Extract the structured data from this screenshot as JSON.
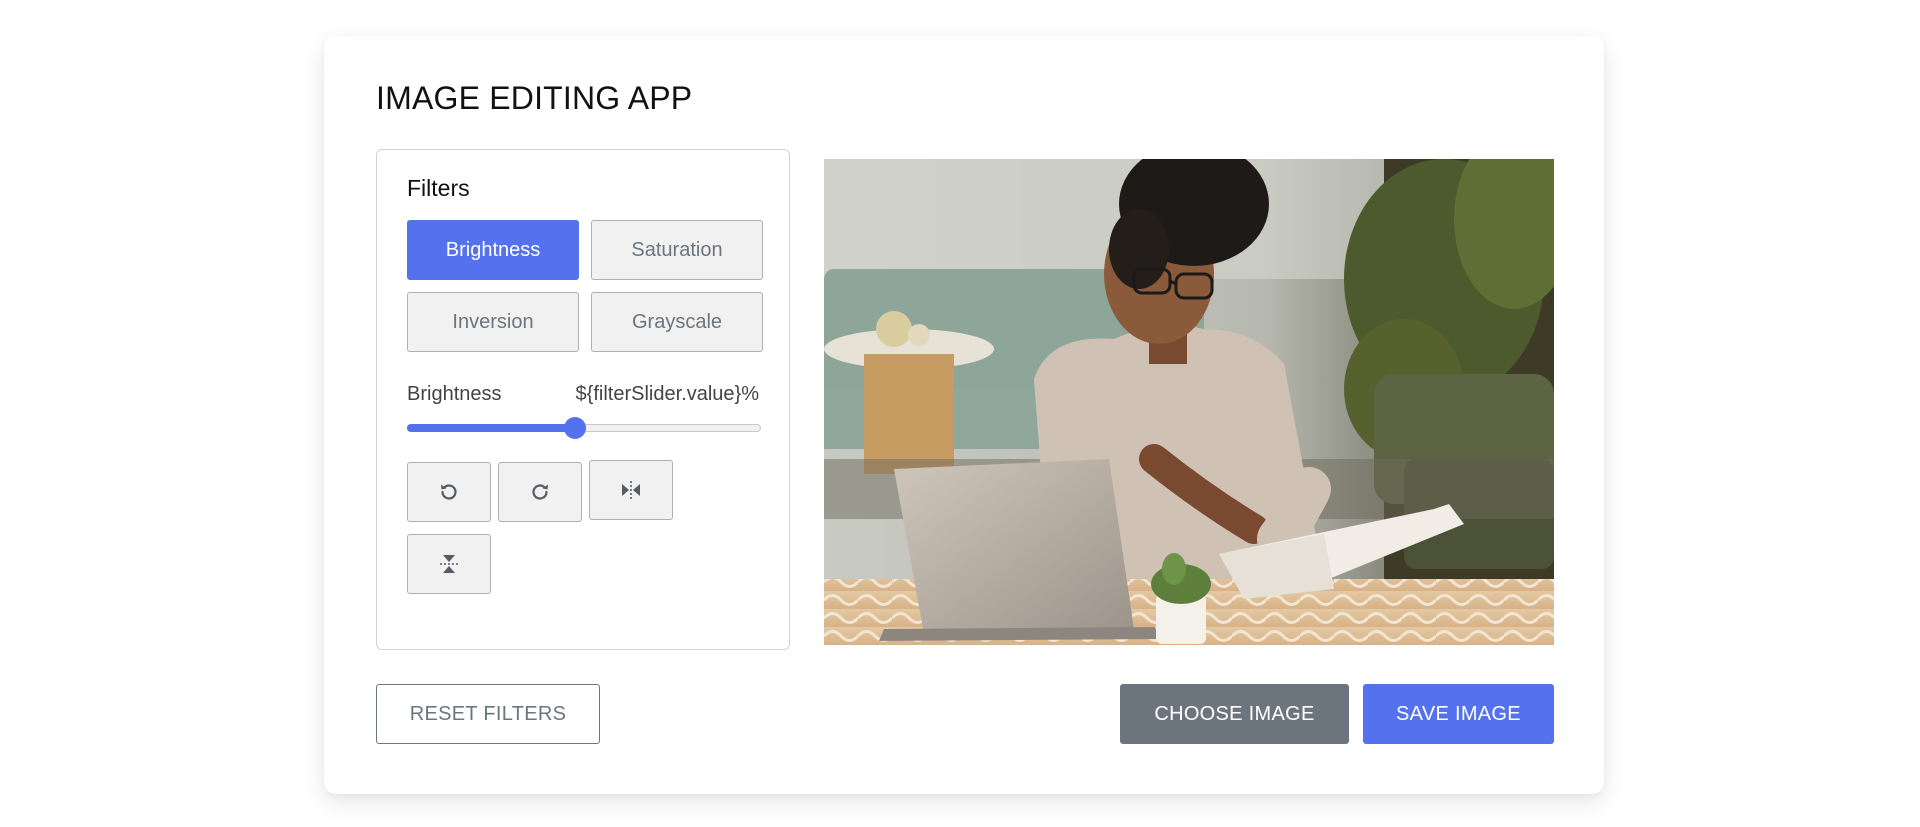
{
  "app": {
    "title": "IMAGE EDITING APP"
  },
  "filters": {
    "heading": "Filters",
    "options": [
      {
        "label": "Brightness",
        "active": true
      },
      {
        "label": "Saturation",
        "active": false
      },
      {
        "label": "Inversion",
        "active": false
      },
      {
        "label": "Grayscale",
        "active": false
      }
    ]
  },
  "slider": {
    "name": "Brightness",
    "value_text": "${filterSlider.value}%",
    "level_fraction": 0.475
  },
  "transform_buttons": [
    {
      "icon": "rotate-left-icon"
    },
    {
      "icon": "rotate-right-icon"
    },
    {
      "icon": "flip-horizontal-icon"
    },
    {
      "icon": "flip-vertical-icon"
    }
  ],
  "preview": {
    "description_icon": "photo-preview"
  },
  "actions": {
    "reset_label": "RESET FILTERS",
    "choose_label": "CHOOSE IMAGE",
    "save_label": "SAVE IMAGE"
  },
  "colors": {
    "accent": "#5471ee",
    "secondary": "#6c757d",
    "button_bg": "#f1f1f1"
  }
}
